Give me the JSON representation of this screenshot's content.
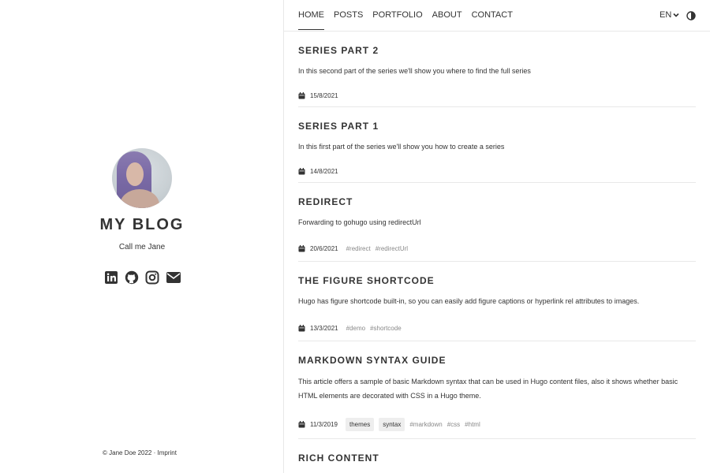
{
  "nav": {
    "items": [
      {
        "label": "HOME",
        "active": true
      },
      {
        "label": "POSTS",
        "active": false
      },
      {
        "label": "PORTFOLIO",
        "active": false
      },
      {
        "label": "ABOUT",
        "active": false
      },
      {
        "label": "CONTACT",
        "active": false
      }
    ],
    "language": "EN"
  },
  "sidebar": {
    "blog_title": "MY BLOG",
    "subtitle": "Call me Jane",
    "socials": [
      "linkedin-icon",
      "github-icon",
      "instagram-icon",
      "email-icon"
    ],
    "footer": {
      "copyright": "© Jane Doe 2022 ·",
      "imprint": "Imprint"
    }
  },
  "posts": [
    {
      "title": "SERIES PART 2",
      "summary": "In this second part of the series we'll show you where to find the full series",
      "date": "15/8/2021",
      "pills": [],
      "tags": []
    },
    {
      "title": "SERIES PART 1",
      "summary": "In this first part of the series we'll show you how to create a series",
      "date": "14/8/2021",
      "pills": [],
      "tags": []
    },
    {
      "title": "REDIRECT",
      "summary": "Forwarding to gohugo using redirectUrl",
      "date": "20/6/2021",
      "pills": [],
      "tags": [
        "#redirect",
        "#redirectUrl"
      ]
    },
    {
      "title": "THE FIGURE SHORTCODE",
      "summary": "Hugo has figure shortcode built-in, so you can easily add figure captions or hyperlink rel attributes to images.",
      "date": "13/3/2021",
      "pills": [],
      "tags": [
        "#demo",
        "#shortcode"
      ]
    },
    {
      "title": "MARKDOWN SYNTAX GUIDE",
      "summary": "This article offers a sample of basic Markdown syntax that can be used in Hugo content files, also it shows whether basic HTML elements are decorated with CSS in a Hugo theme.",
      "date": "11/3/2019",
      "pills": [
        "themes",
        "syntax"
      ],
      "tags": [
        "#markdown",
        "#css",
        "#html"
      ]
    },
    {
      "title": "RICH CONTENT",
      "summary": "",
      "date": "",
      "pills": [],
      "tags": []
    }
  ]
}
